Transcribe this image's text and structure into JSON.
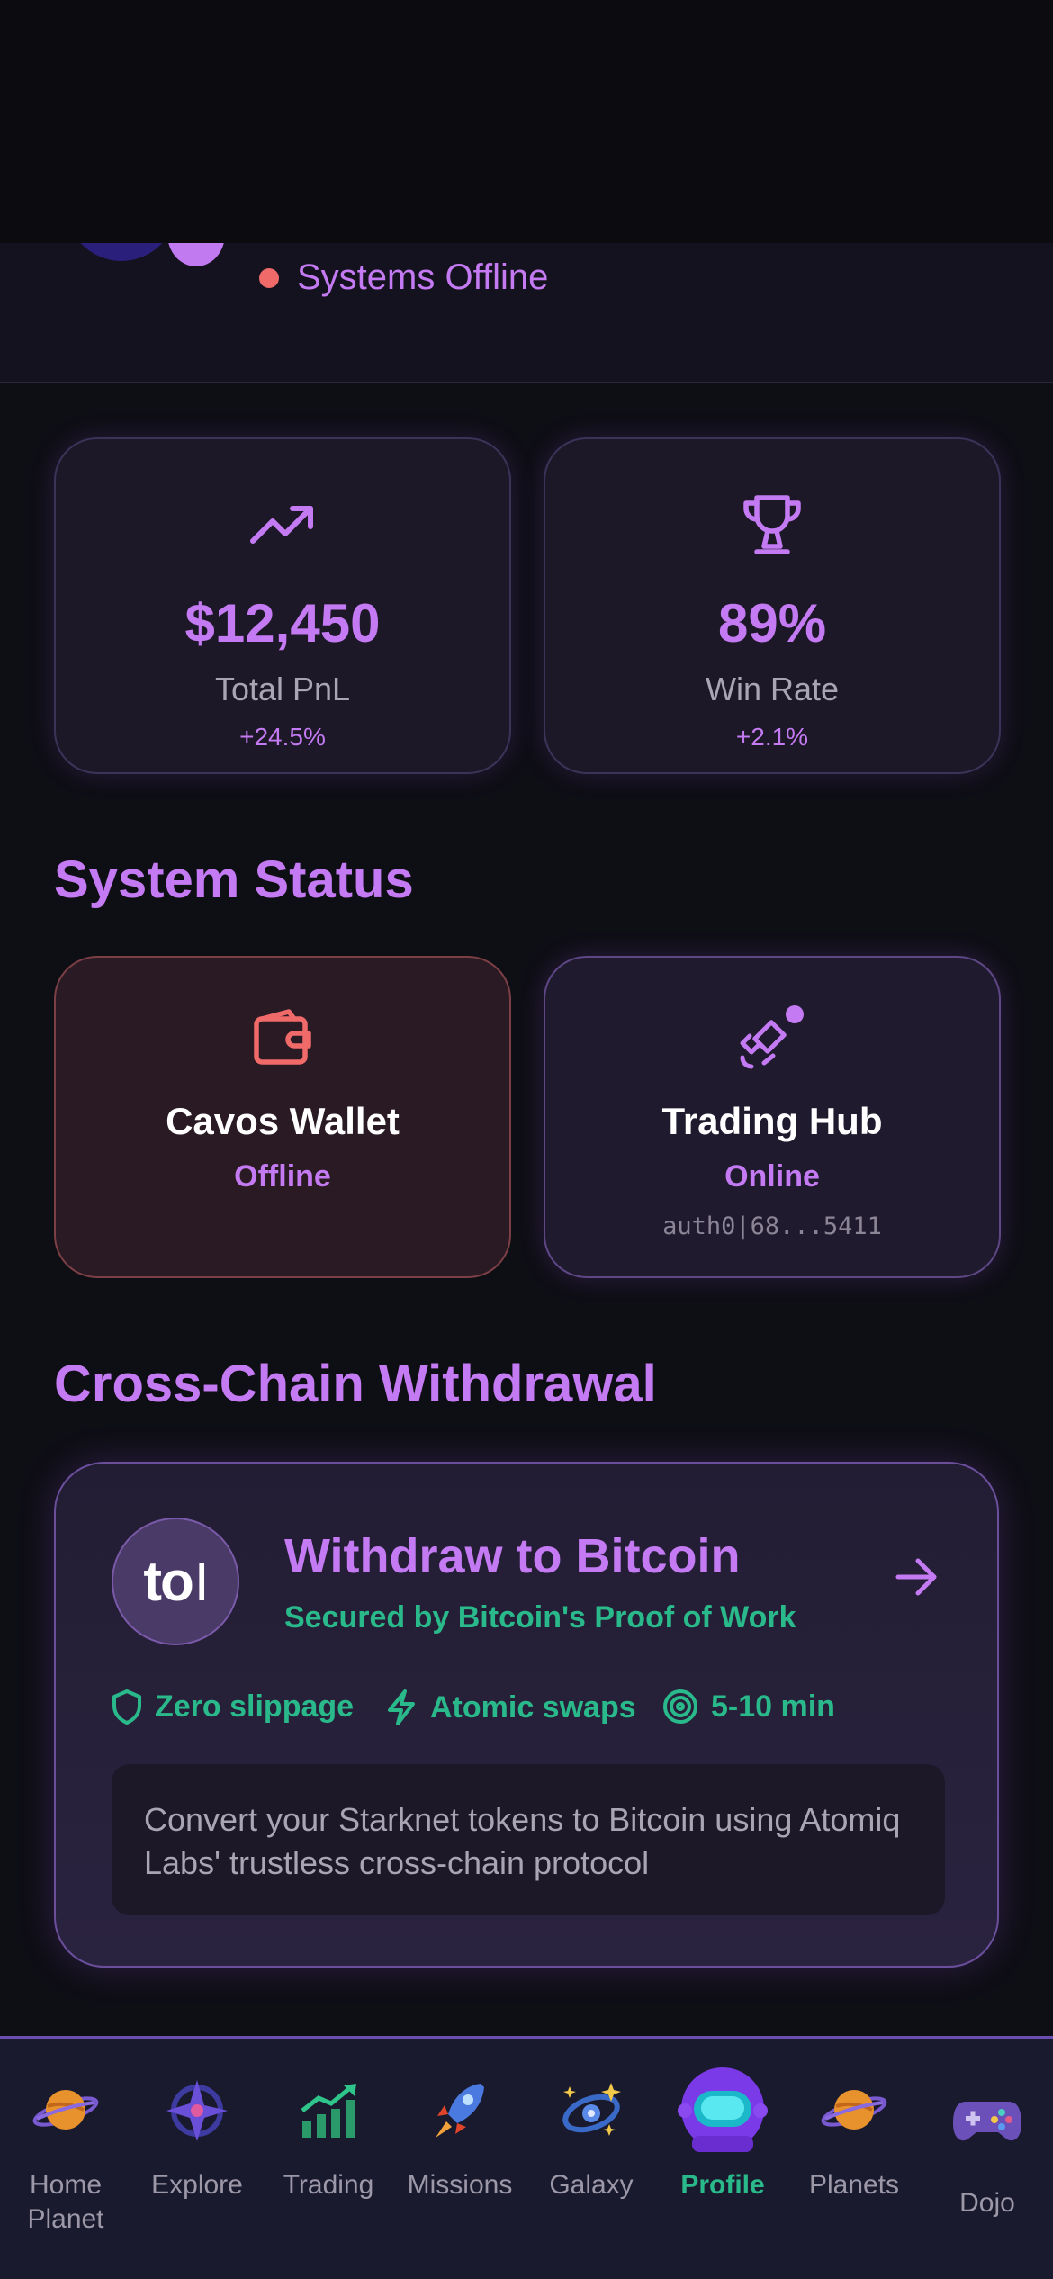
{
  "header": {
    "status_text": "Systems Offline"
  },
  "stats": [
    {
      "icon": "trending-up-icon",
      "value": "$12,450",
      "label": "Total PnL",
      "change": "+24.5%"
    },
    {
      "icon": "trophy-icon",
      "value": "89%",
      "label": "Win Rate",
      "change": "+2.1%"
    }
  ],
  "system_status": {
    "title": "System Status",
    "cards": [
      {
        "icon": "wallet-icon",
        "name": "Cavos Wallet",
        "state": "Offline",
        "id": ""
      },
      {
        "icon": "satellite-icon",
        "name": "Trading Hub",
        "state": "Online",
        "id": "auth0|68...5411"
      }
    ]
  },
  "withdrawal": {
    "section_title": "Cross-Chain Withdrawal",
    "logo_text": "to",
    "title": "Withdraw to Bitcoin",
    "subtitle": "Secured by Bitcoin's Proof of Work",
    "features": [
      {
        "icon": "shield-icon",
        "label": "Zero slippage"
      },
      {
        "icon": "lightning-icon",
        "label": "Atomic swaps"
      },
      {
        "icon": "target-icon",
        "label": "5-10 min"
      }
    ],
    "description": "Convert your Starknet tokens to Bitcoin using Atomiq Labs' trustless cross-chain protocol"
  },
  "nav": {
    "active": "Profile",
    "items": [
      {
        "icon": "planet-icon",
        "label": "Home Planet"
      },
      {
        "icon": "shuriken-icon",
        "label": "Explore"
      },
      {
        "icon": "chart-icon",
        "label": "Trading"
      },
      {
        "icon": "rocket-icon",
        "label": "Missions"
      },
      {
        "icon": "galaxy-icon",
        "label": "Galaxy"
      },
      {
        "icon": "astronaut-helmet-icon",
        "label": "Profile"
      },
      {
        "icon": "planet-icon",
        "label": "Planets"
      },
      {
        "icon": "gamepad-icon",
        "label": "Dojo"
      }
    ]
  },
  "colors": {
    "accent": "#c47af2",
    "success": "#2ab98a",
    "danger": "#f06a6a",
    "background": "#0e0e15"
  }
}
